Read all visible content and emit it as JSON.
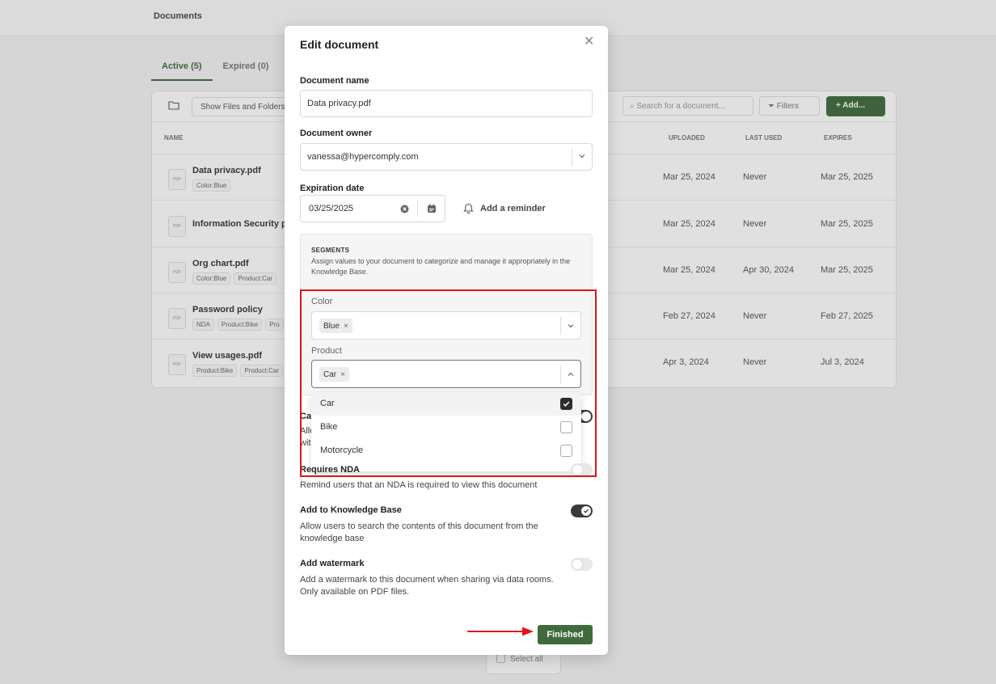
{
  "background": {
    "page_title": "Documents",
    "tabs": [
      {
        "label": "Active (5)"
      },
      {
        "label": "Expired (0)"
      }
    ],
    "toolbar": {
      "show_files_label": "Show Files and Folders",
      "search_placeholder": "Search for a document...",
      "filters_label": "Filters",
      "add_label": "Add..."
    },
    "columns": {
      "name": "NAME",
      "uploaded": "UPLOADED",
      "last_used": "LAST USED",
      "expires": "EXPIRES"
    },
    "rows": [
      {
        "name": "Data privacy.pdf",
        "tags": [
          "Color:Blue"
        ],
        "uploaded": "Mar 25, 2024",
        "last_used": "Never",
        "expires": "Mar 25, 2025"
      },
      {
        "name": "Information Security policy",
        "tags": [],
        "uploaded": "Mar 25, 2024",
        "last_used": "Never",
        "expires": "Mar 25, 2025"
      },
      {
        "name": "Org chart.pdf",
        "tags": [
          "Color:Blue",
          "Product:Car"
        ],
        "uploaded": "Mar 25, 2024",
        "last_used": "Apr 30, 2024",
        "expires": "Mar 25, 2025"
      },
      {
        "name": "Password policy",
        "tags": [
          "NDA",
          "Product:Bike",
          "Pro"
        ],
        "uploaded": "Feb 27, 2024",
        "last_used": "Never",
        "expires": "Feb 27, 2025"
      },
      {
        "name": "View usages.pdf",
        "tags": [
          "Product:Bike",
          "Product:Car"
        ],
        "uploaded": "Apr 3, 2024",
        "last_used": "Never",
        "expires": "Jul 3, 2024"
      }
    ],
    "pdf_badge": "PDF",
    "select_all": "Select all"
  },
  "modal": {
    "title": "Edit document",
    "close_glyph": "✕",
    "document_name_label": "Document name",
    "document_name_value": "Data privacy.pdf",
    "document_owner_label": "Document owner",
    "document_owner_value": "vanessa@hypercomply.com",
    "expiration_label": "Expiration date",
    "expiration_value": "03/25/2025",
    "reminder_label": "Add a reminder",
    "segments": {
      "title": "SEGMENTS",
      "description": "Assign values to your document to categorize and manage it appropriately in the Knowledge Base.",
      "color_label": "Color",
      "color_chip": "Blue",
      "product_label": "Product",
      "product_chip": "Car",
      "chip_remove": "×",
      "product_options": [
        {
          "label": "Car",
          "checked": true
        },
        {
          "label": "Bike",
          "checked": false
        },
        {
          "label": "Motorcycle",
          "checked": false
        }
      ]
    },
    "partial": {
      "title_fragment": "Ca",
      "desc_fragment_1": "Allo",
      "desc_fragment_2": "wit"
    },
    "requires_nda": {
      "title": "Requires NDA",
      "description": "Remind users that an NDA is required to view this document",
      "on": false
    },
    "knowledge_base": {
      "title": "Add to Knowledge Base",
      "description": "Allow users to search the contents of this document from the knowledge base",
      "on": true
    },
    "watermark": {
      "title": "Add watermark",
      "description_line1": "Add a watermark to this document when sharing via data rooms.",
      "description_line2": "Only available on PDF files.",
      "on": false
    },
    "finished_label": "Finished"
  },
  "annotation_color": "#e0141a",
  "accent_color": "#3f6b3c"
}
